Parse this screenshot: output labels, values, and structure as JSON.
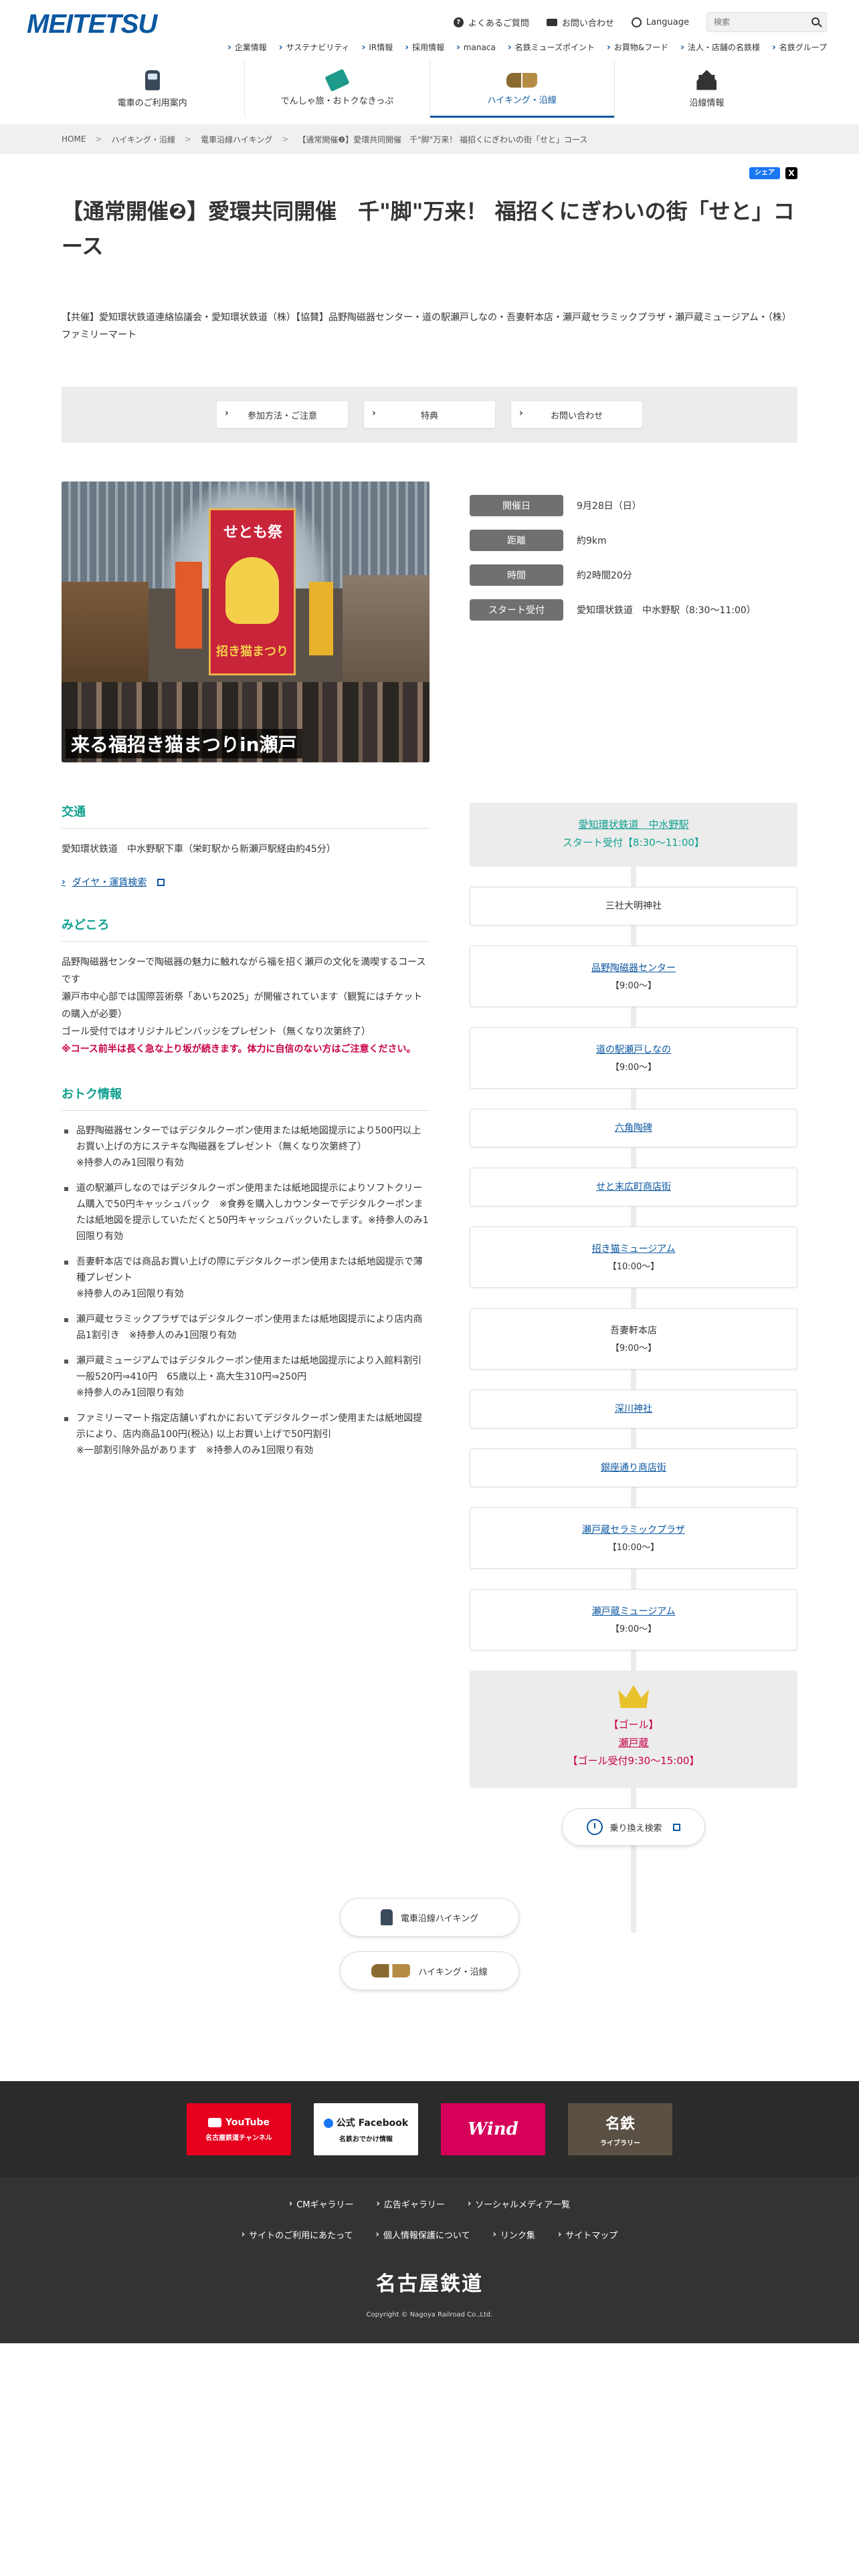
{
  "header": {
    "logo": "MEITETSU",
    "util": {
      "faq": "よくあるご質問",
      "contact": "お問い合わせ",
      "language": "Language",
      "search_placeholder": "検索"
    },
    "sub_nav": [
      "企業情報",
      "サステナビリティ",
      "IR情報",
      "採用情報",
      "manaca",
      "名鉄ミューズポイント",
      "お買物&フード",
      "法人・店舗の名鉄様",
      "名鉄グループ"
    ],
    "main_nav": [
      "電車のご利用案内",
      "でんしゃ旅・おトクなきっぷ",
      "ハイキング・沿線",
      "沿線情報"
    ]
  },
  "breadcrumb": [
    "HOME",
    "ハイキング・沿線",
    "電車沿線ハイキング",
    "【通常開催❷】愛環共同開催　千\"脚\"万来！ 福招くにぎわいの街「せと」コース"
  ],
  "share": {
    "fb": "シェア",
    "x": "X"
  },
  "title": "【通常開催❷】愛環共同開催　千\"脚\"万来！ 福招くにぎわいの街「せと」コース",
  "organizers": "【共催】愛知環状鉄道連絡協議会・愛知環状鉄道（株）【協賛】品野陶磁器センター・道の駅瀬戸しなの・吾妻軒本店・瀬戸蔵セラミックプラザ・瀬戸蔵ミュージアム・（株）ファミリーマート",
  "anchors": [
    "参加方法・ご注意",
    "特典",
    "お問い合わせ"
  ],
  "hero": {
    "banner_top": "せとも祭",
    "banner_bottom": "招き猫まつり",
    "caption": "来る福招き猫まつりin瀬戸"
  },
  "info": [
    {
      "label": "開催日",
      "value": "9月28日（日）"
    },
    {
      "label": "距離",
      "value": "約9km"
    },
    {
      "label": "時間",
      "value": "約2時間20分"
    },
    {
      "label": "スタート受付",
      "value": "愛知環状鉄道　中水野駅（8:30〜11:00）"
    }
  ],
  "access": {
    "title": "交通",
    "text": "愛知環状鉄道　中水野駅下車（栄町駅から新瀬戸駅経由約45分）",
    "link": "ダイヤ・運賃検索"
  },
  "highlights": {
    "title": "みどころ",
    "lines": [
      "品野陶磁器センターで陶磁器の魅力に触れながら福を招く瀬戸の文化を満喫するコースです",
      "瀬戸市中心部では国際芸術祭「あいち2025」が開催されています（観覧にはチケットの購入が必要）",
      "ゴール受付ではオリジナルピンバッジをプレゼント（無くなり次第終了）"
    ],
    "warning": "※コース前半は長く急な上り坂が続きます。体力に自信のない方はご注意ください。"
  },
  "benefits": {
    "title": "おトク情報",
    "items": [
      "品野陶磁器センターではデジタルクーポン使用または紙地図提示により500円以上お買い上げの方にステキな陶磁器をプレゼント（無くなり次第終了）\n※持参人のみ1回限り有効",
      "道の駅瀬戸しなのではデジタルクーポン使用または紙地図提示によりソフトクリーム購入で50円キャッシュバック　※食券を購入しカウンターでデジタルクーポンまたは紙地図を提示していただくと50円キャッシュバックいたします。※持参人のみ1回限り有効",
      "吾妻軒本店では商品お買い上げの際にデジタルクーポン使用または紙地図提示で薄種プレゼント\n※持参人のみ1回限り有効",
      "瀬戸蔵セラミックプラザではデジタルクーポン使用または紙地図提示により店内商品1割引き　※持参人のみ1回限り有効",
      "瀬戸蔵ミュージアムではデジタルクーポン使用または紙地図提示により入館料割引\n一般520円⇒410円　65歳以上・高大生310円⇒250円\n※持参人のみ1回限り有効",
      "ファミリーマート指定店舗いずれかにおいてデジタルクーポン使用または紙地図提示により、店内商品100円(税込) 以上お買い上げで50円割引\n※一部割引除外品があります　※持参人のみ1回限り有効"
    ]
  },
  "route": {
    "start_link": "愛知環状鉄道　中水野駅",
    "start_sub": "スタート受付【8:30〜11:00】",
    "stops": [
      {
        "name": "三社大明神社",
        "link": false,
        "time": ""
      },
      {
        "name": "品野陶磁器センター",
        "link": true,
        "time": "【9:00〜】"
      },
      {
        "name": "道の駅瀬戸しなの",
        "link": true,
        "time": "【9:00〜】"
      },
      {
        "name": "六角陶碑",
        "link": true,
        "time": ""
      },
      {
        "name": "せと末広町商店街",
        "link": true,
        "time": ""
      },
      {
        "name": "招き猫ミュージアム",
        "link": true,
        "time": "【10:00〜】"
      },
      {
        "name": "吾妻軒本店",
        "link": false,
        "time": "【9:00〜】"
      },
      {
        "name": "深川神社",
        "link": true,
        "time": ""
      },
      {
        "name": "銀座通り商店街",
        "link": true,
        "time": ""
      },
      {
        "name": "瀬戸蔵セラミックプラザ",
        "link": true,
        "time": "【10:00〜】"
      },
      {
        "name": "瀬戸蔵ミュージアム",
        "link": true,
        "time": "【9:00〜】"
      }
    ],
    "goal_label": "【ゴール】",
    "goal_name": "瀬戸蔵",
    "goal_time": "【ゴール受付9:30〜15:00】",
    "transfer": "乗り換え検索"
  },
  "bottom_links": [
    "電車沿線ハイキング",
    "ハイキング・沿線"
  ],
  "footer": {
    "banners": {
      "yt_1": "YouTube",
      "yt_2": "名古屋鉄道チャンネル",
      "fb_1": "公式 Facebook",
      "fb_2": "名鉄おでかけ情報",
      "wind": "Wind",
      "lib_1": "名鉄",
      "lib_2": "ライブラリー"
    },
    "links1": [
      "CMギャラリー",
      "広告ギャラリー",
      "ソーシャルメディア一覧"
    ],
    "links2": [
      "サイトのご利用にあたって",
      "個人情報保護について",
      "リンク集",
      "サイトマップ"
    ],
    "brand": "名古屋鉄道",
    "copyright": "Copyright © Nagoya Railroad Co.,Ltd."
  }
}
